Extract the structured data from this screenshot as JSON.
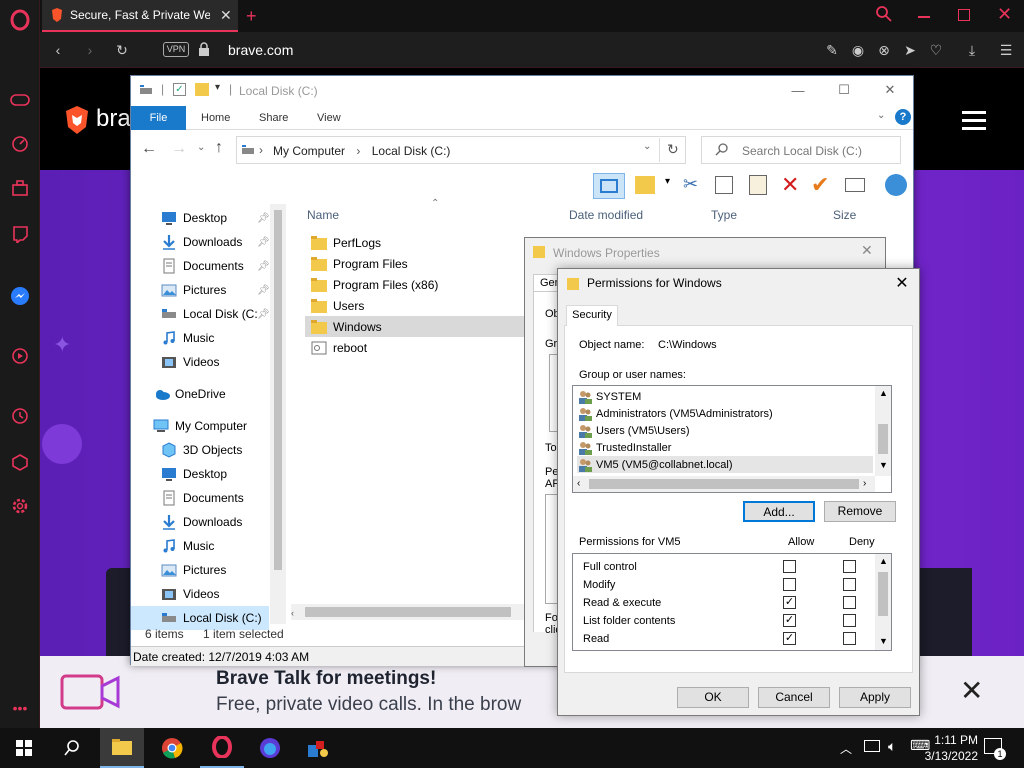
{
  "browser": {
    "tab_title": "Secure, Fast & Private Web",
    "vpn_label": "VPN",
    "url": "brave.com"
  },
  "page": {
    "logo_text": "bra",
    "banner_title": "Brave Talk for meetings!",
    "banner_subtitle": "Free, private video calls. In the brow"
  },
  "explorer": {
    "title": "Local Disk (C:)",
    "ribbon_tabs": [
      "File",
      "Home",
      "Share",
      "View"
    ],
    "breadcrumb": [
      "My Computer",
      "Local Disk (C:)"
    ],
    "breadcrumb_sep": "›",
    "search_placeholder": "Search Local Disk (C:)",
    "nav": {
      "quick_access": [
        {
          "label": "Desktop",
          "icon": "desktop-icon"
        },
        {
          "label": "Downloads",
          "icon": "downloads-icon"
        },
        {
          "label": "Documents",
          "icon": "documents-icon"
        },
        {
          "label": "Pictures",
          "icon": "pictures-icon"
        },
        {
          "label": "Local Disk (C:",
          "icon": "drive-icon"
        },
        {
          "label": "Music",
          "icon": "music-icon"
        },
        {
          "label": "Videos",
          "icon": "videos-icon"
        }
      ],
      "onedrive": "OneDrive",
      "my_computer": "My Computer",
      "computer_items": [
        {
          "label": "3D Objects",
          "icon": "3d-objects-icon"
        },
        {
          "label": "Desktop",
          "icon": "desktop-icon"
        },
        {
          "label": "Documents",
          "icon": "documents-icon"
        },
        {
          "label": "Downloads",
          "icon": "downloads-icon"
        },
        {
          "label": "Music",
          "icon": "music-icon"
        },
        {
          "label": "Pictures",
          "icon": "pictures-icon"
        },
        {
          "label": "Videos",
          "icon": "videos-icon"
        },
        {
          "label": "Local Disk (C:)",
          "icon": "drive-icon"
        }
      ]
    },
    "columns": [
      "Name",
      "Date modified",
      "Type",
      "Size"
    ],
    "files": [
      {
        "name": "PerfLogs",
        "kind": "folder"
      },
      {
        "name": "Program Files",
        "kind": "folder"
      },
      {
        "name": "Program Files (x86)",
        "kind": "folder"
      },
      {
        "name": "Users",
        "kind": "folder"
      },
      {
        "name": "Windows",
        "kind": "folder",
        "selected": true
      },
      {
        "name": "reboot",
        "kind": "file"
      }
    ],
    "status_items": "6 items",
    "status_selected": "1 item selected",
    "date_created": "Date created: 12/7/2019 4:03 AM"
  },
  "properties": {
    "title": "Windows Properties",
    "fragments": [
      "Gen",
      "Ob",
      "Gr",
      "To",
      "Pe",
      "AP",
      "Fo",
      "clic"
    ]
  },
  "permissions": {
    "title": "Permissions for Windows",
    "tab": "Security",
    "object_name_label": "Object name:",
    "object_name": "C:\\Windows",
    "group_label": "Group or user names:",
    "groups": [
      "SYSTEM",
      "Administrators (VM5\\Administrators)",
      "Users (VM5\\Users)",
      "TrustedInstaller",
      "VM5 (VM5@collabnet.local)"
    ],
    "add_button": "Add...",
    "remove_button": "Remove",
    "perm_for_label": "Permissions for VM5",
    "allow_label": "Allow",
    "deny_label": "Deny",
    "permissions": [
      {
        "name": "Full control",
        "allow": false,
        "deny": false
      },
      {
        "name": "Modify",
        "allow": false,
        "deny": false
      },
      {
        "name": "Read & execute",
        "allow": true,
        "deny": false
      },
      {
        "name": "List folder contents",
        "allow": true,
        "deny": false
      },
      {
        "name": "Read",
        "allow": true,
        "deny": false
      }
    ],
    "check_mark": "✓",
    "ok": "OK",
    "cancel": "Cancel",
    "apply": "Apply"
  },
  "taskbar": {
    "time": "1:11 PM",
    "date": "3/13/2022",
    "notification_count": "1"
  },
  "colors": {
    "accent": "#1979ca",
    "opera_red": "#e8335a",
    "brave_purple": "#6b22c4"
  }
}
